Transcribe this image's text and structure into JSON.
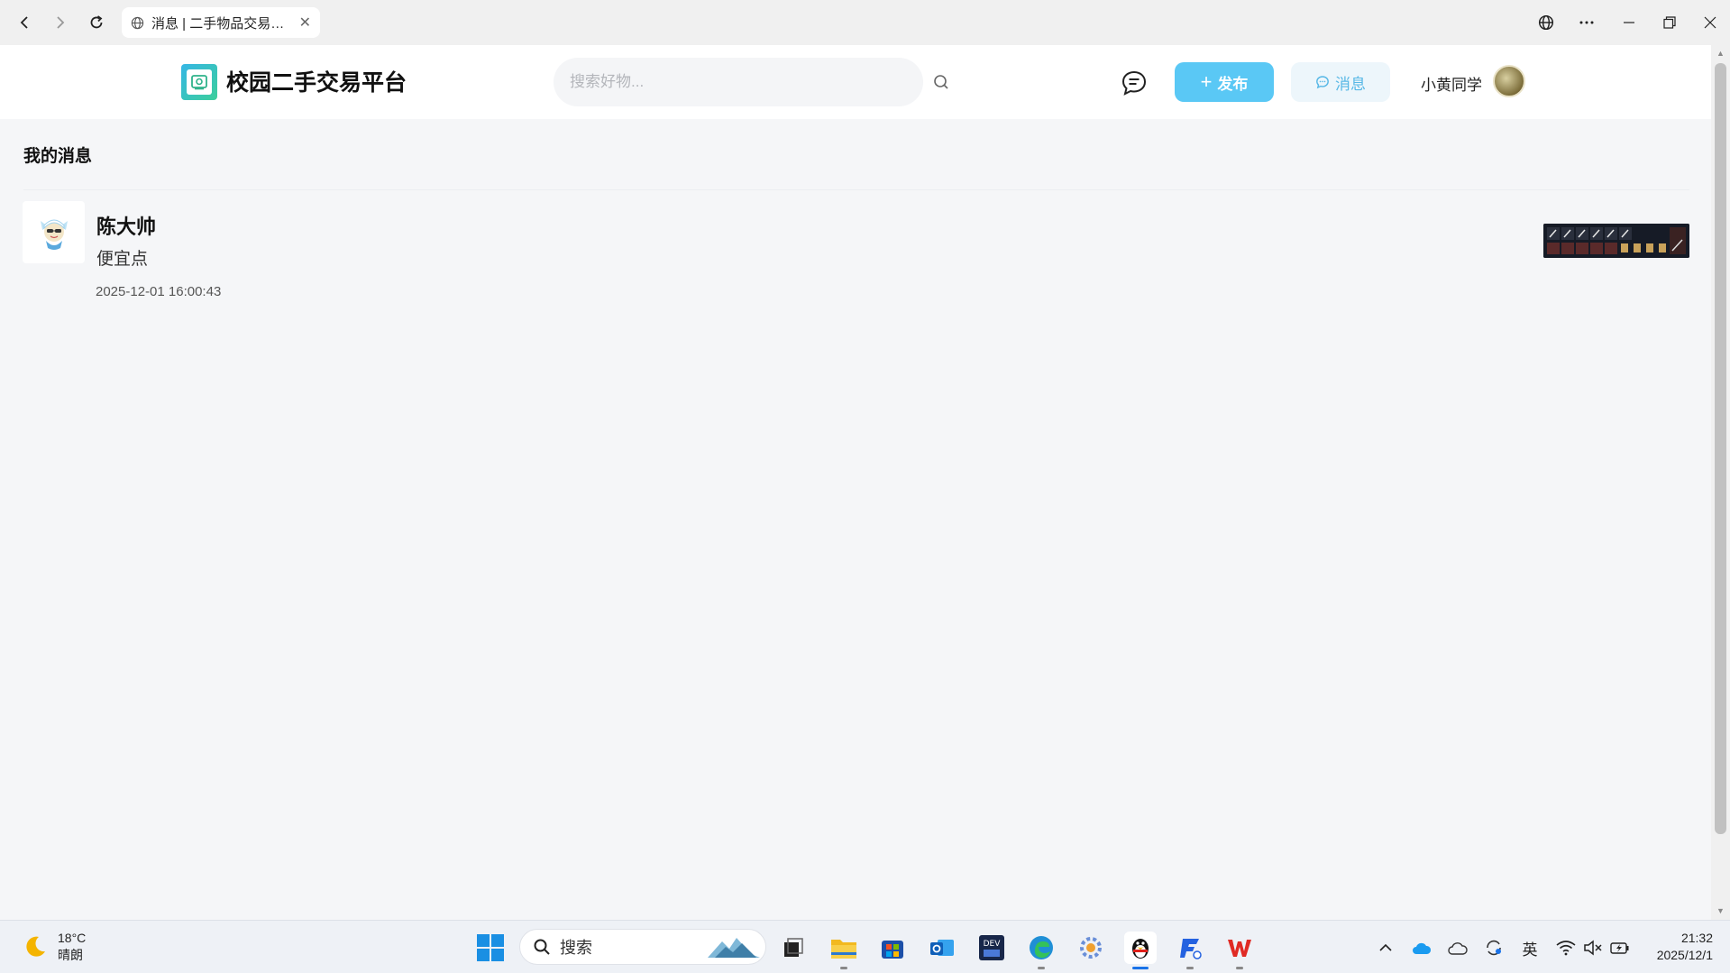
{
  "browser": {
    "tab_title": "消息 | 二手物品交易…",
    "tab_close": "✕"
  },
  "header": {
    "site_title": "校园二手交易平台",
    "search_placeholder": "搜索好物...",
    "publish_label": "发布",
    "publish_plus": "+",
    "messages_label": "消息",
    "username": "小黄同学"
  },
  "main": {
    "section_title": "我的消息",
    "messages": [
      {
        "sender": "陈大帅",
        "text": "便宜点",
        "time": "2025-12-01 16:00:43"
      }
    ]
  },
  "taskbar": {
    "weather_temp": "18°C",
    "weather_desc": "晴朗",
    "search_label": "搜索",
    "ime": "英",
    "time": "21:32",
    "date": "2025/12/1"
  },
  "colors": {
    "accent": "#5ac8f5",
    "message_btn_text": "#58b8e6",
    "page_bg": "#f5f6f8"
  },
  "icons": {
    "back": "chevron-left-icon",
    "forward": "chevron-right-icon",
    "reload": "reload-icon",
    "globe": "globe-icon",
    "search": "search-icon",
    "chat": "chat-bubble-icon",
    "windows": "windows-start-icon"
  }
}
